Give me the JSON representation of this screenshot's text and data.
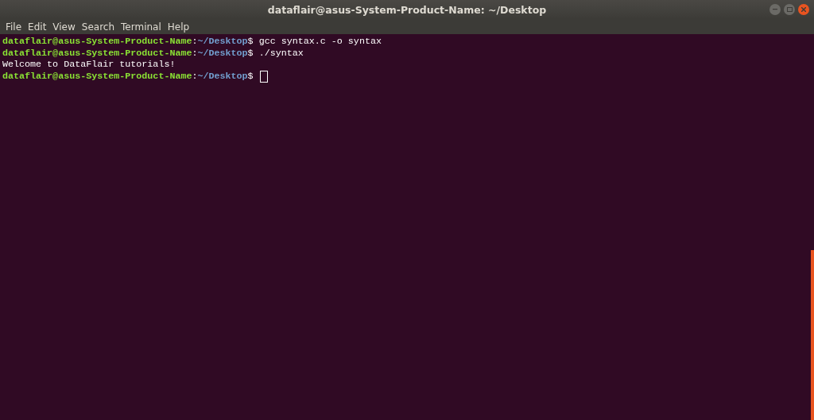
{
  "window": {
    "title": "dataflair@asus-System-Product-Name: ~/Desktop"
  },
  "menu": [
    "File",
    "Edit",
    "View",
    "Search",
    "Terminal",
    "Help"
  ],
  "lines": [
    {
      "kind": "prompt",
      "user_host": "dataflair@asus-System-Product-Name",
      "separator": ":",
      "path": "~/Desktop",
      "symbol": "$",
      "command": "gcc syntax.c -o syntax",
      "cursor": false
    },
    {
      "kind": "prompt",
      "user_host": "dataflair@asus-System-Product-Name",
      "separator": ":",
      "path": "~/Desktop",
      "symbol": "$",
      "command": "./syntax",
      "cursor": false
    },
    {
      "kind": "output",
      "text": "Welcome to DataFlair tutorials!"
    },
    {
      "kind": "prompt",
      "user_host": "dataflair@asus-System-Product-Name",
      "separator": ":",
      "path": "~/Desktop",
      "symbol": "$",
      "cursor": true
    }
  ]
}
